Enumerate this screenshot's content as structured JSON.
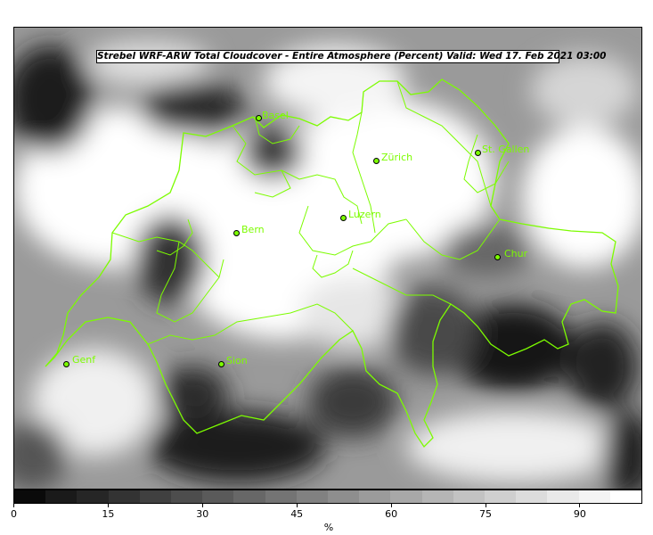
{
  "title": "Strebel WRF-ARW Total Cloudcover - Entire Atmosphere (Percent)   Valid: Wed 17. Feb 2021 03:00",
  "cities": [
    {
      "name": "Basel"
    },
    {
      "name": "Zürich"
    },
    {
      "name": "St. Gallen"
    },
    {
      "name": "Luzern"
    },
    {
      "name": "Bern"
    },
    {
      "name": "Chur"
    },
    {
      "name": "Genf"
    },
    {
      "name": "Sion"
    }
  ],
  "colorbar": {
    "unit": "%",
    "ticks": [
      "0",
      "15",
      "30",
      "45",
      "60",
      "75",
      "90"
    ],
    "range": [
      0,
      100
    ],
    "colors": [
      "#0a0a0a",
      "#1a1a1a",
      "#262626",
      "#333333",
      "#404040",
      "#4d4d4d",
      "#5a5a5a",
      "#676767",
      "#747474",
      "#818181",
      "#8e8e8e",
      "#9b9b9b",
      "#a8a8a8",
      "#b5b5b5",
      "#c2c2c2",
      "#cfcfcf",
      "#dcdcdc",
      "#e9e9e9",
      "#f4f4f4",
      "#ffffff"
    ]
  },
  "colors": {
    "border": "#7CFC00",
    "background": "#ffffff"
  }
}
